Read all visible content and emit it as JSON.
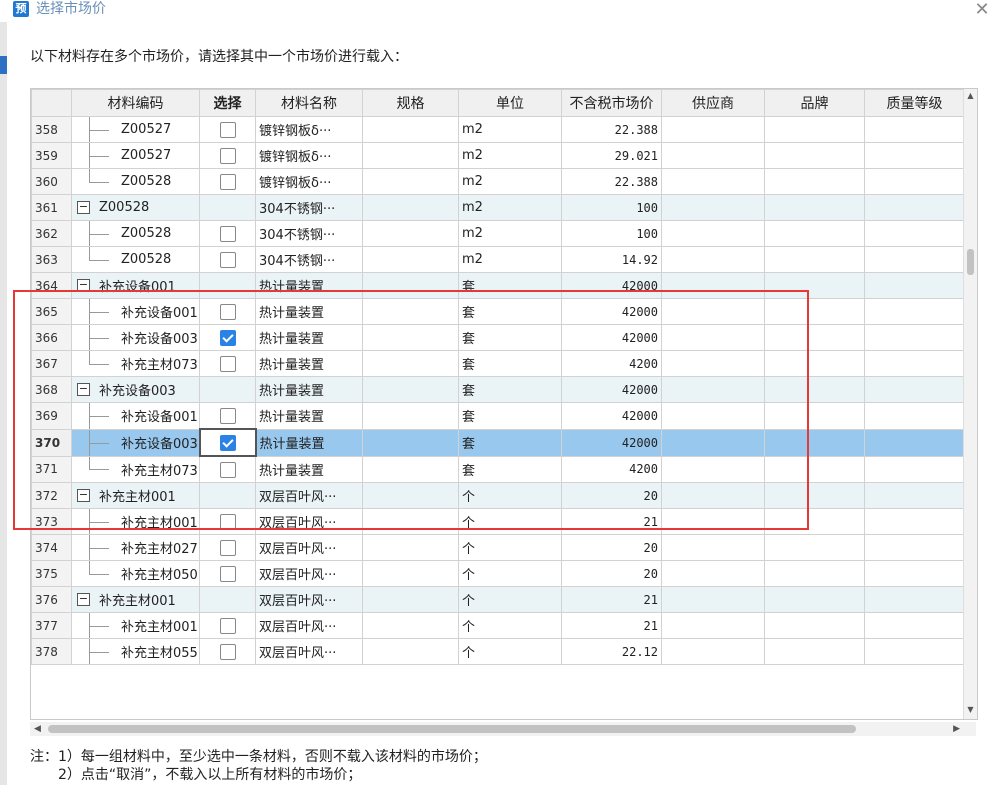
{
  "window": {
    "icon_text": "预",
    "title": "选择市场价",
    "close_symbol": "✕"
  },
  "instruction": "以下材料存在多个市场价，请选择其中一个市场价进行载入：",
  "table": {
    "columns": [
      "",
      "材料编码",
      "选择",
      "材料名称",
      "规格",
      "单位",
      "不含税市场价",
      "供应商",
      "品牌",
      "质量等级"
    ],
    "rows": [
      {
        "num": "358",
        "code": "Z00527",
        "parent": false,
        "last": false,
        "checkbox": true,
        "checked": false,
        "name": "镀锌钢板δ···",
        "spec": "",
        "unit": "m2",
        "price": "22.388"
      },
      {
        "num": "359",
        "code": "Z00527",
        "parent": false,
        "last": false,
        "checkbox": true,
        "checked": false,
        "name": "镀锌钢板δ···",
        "spec": "",
        "unit": "m2",
        "price": "29.021"
      },
      {
        "num": "360",
        "code": "Z00528",
        "parent": false,
        "last": true,
        "checkbox": true,
        "checked": false,
        "name": "镀锌钢板δ···",
        "spec": "",
        "unit": "m2",
        "price": "22.388"
      },
      {
        "num": "361",
        "code": "Z00528",
        "parent": true,
        "last": false,
        "checkbox": false,
        "checked": false,
        "name": "304不锈钢···",
        "spec": "",
        "unit": "m2",
        "price": "100"
      },
      {
        "num": "362",
        "code": "Z00528",
        "parent": false,
        "last": false,
        "checkbox": true,
        "checked": false,
        "name": "304不锈钢···",
        "spec": "",
        "unit": "m2",
        "price": "100"
      },
      {
        "num": "363",
        "code": "Z00528",
        "parent": false,
        "last": true,
        "checkbox": true,
        "checked": false,
        "name": "304不锈钢···",
        "spec": "",
        "unit": "m2",
        "price": "14.92"
      },
      {
        "num": "364",
        "code": "补充设备001",
        "parent": true,
        "last": false,
        "checkbox": false,
        "checked": false,
        "name": "热计量装置",
        "spec": "",
        "unit": "套",
        "price": "42000"
      },
      {
        "num": "365",
        "code": "补充设备001",
        "parent": false,
        "last": false,
        "checkbox": true,
        "checked": false,
        "name": "热计量装置",
        "spec": "",
        "unit": "套",
        "price": "42000"
      },
      {
        "num": "366",
        "code": "补充设备003",
        "parent": false,
        "last": false,
        "checkbox": true,
        "checked": true,
        "name": "热计量装置",
        "spec": "",
        "unit": "套",
        "price": "42000"
      },
      {
        "num": "367",
        "code": "补充主材073",
        "parent": false,
        "last": true,
        "checkbox": true,
        "checked": false,
        "name": "热计量装置",
        "spec": "",
        "unit": "套",
        "price": "4200"
      },
      {
        "num": "368",
        "code": "补充设备003",
        "parent": true,
        "last": false,
        "checkbox": false,
        "checked": false,
        "name": "热计量装置",
        "spec": "",
        "unit": "套",
        "price": "42000"
      },
      {
        "num": "369",
        "code": "补充设备001",
        "parent": false,
        "last": false,
        "checkbox": true,
        "checked": false,
        "name": "热计量装置",
        "spec": "",
        "unit": "套",
        "price": "42000"
      },
      {
        "num": "370",
        "code": "补充设备003",
        "parent": false,
        "last": false,
        "checkbox": true,
        "checked": true,
        "name": "热计量装置",
        "spec": "",
        "unit": "套",
        "price": "42000",
        "selected": true
      },
      {
        "num": "371",
        "code": "补充主材073",
        "parent": false,
        "last": true,
        "checkbox": true,
        "checked": false,
        "name": "热计量装置",
        "spec": "",
        "unit": "套",
        "price": "4200"
      },
      {
        "num": "372",
        "code": "补充主材001",
        "parent": true,
        "last": false,
        "checkbox": false,
        "checked": false,
        "name": "双层百叶风···",
        "spec": "",
        "unit": "个",
        "price": "20"
      },
      {
        "num": "373",
        "code": "补充主材001",
        "parent": false,
        "last": false,
        "checkbox": true,
        "checked": false,
        "name": "双层百叶风···",
        "spec": "",
        "unit": "个",
        "price": "21"
      },
      {
        "num": "374",
        "code": "补充主材027",
        "parent": false,
        "last": false,
        "checkbox": true,
        "checked": false,
        "name": "双层百叶风···",
        "spec": "",
        "unit": "个",
        "price": "20"
      },
      {
        "num": "375",
        "code": "补充主材050",
        "parent": false,
        "last": true,
        "checkbox": true,
        "checked": false,
        "name": "双层百叶风···",
        "spec": "",
        "unit": "个",
        "price": "20"
      },
      {
        "num": "376",
        "code": "补充主材001",
        "parent": true,
        "last": false,
        "checkbox": false,
        "checked": false,
        "name": "双层百叶风···",
        "spec": "",
        "unit": "个",
        "price": "21"
      },
      {
        "num": "377",
        "code": "补充主材001",
        "parent": false,
        "last": false,
        "checkbox": true,
        "checked": false,
        "name": "双层百叶风···",
        "spec": "",
        "unit": "个",
        "price": "21"
      },
      {
        "num": "378",
        "code": "补充主材055",
        "parent": false,
        "last": false,
        "checkbox": true,
        "checked": false,
        "name": "双层百叶风···",
        "spec": "",
        "unit": "个",
        "price": "22.12"
      }
    ]
  },
  "notes": {
    "line1": "注：1）每一组材料中，至少选中一条材料，否则不载入该材料的市场价；",
    "line2": "2）点击“取消”，不载入以上所有材料的市场价；"
  },
  "colors": {
    "selected_row": "#99c8ef",
    "group_row": "#eaf3f6",
    "checkbox_checked": "#2a82e4",
    "highlight_box": "#e53935"
  }
}
